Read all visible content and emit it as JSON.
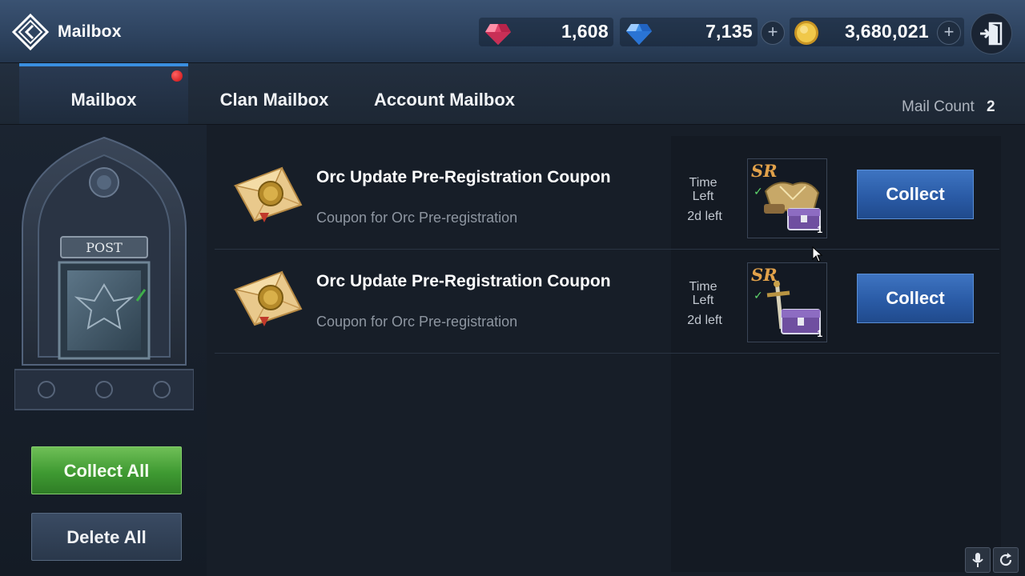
{
  "window": {
    "title": "Mailbox"
  },
  "currencies": [
    {
      "name": "ruby-gem-icon",
      "value": "1,608",
      "color": "#e0436a"
    },
    {
      "name": "blue-diamond-icon",
      "value": "7,135",
      "color": "#3d8ee8"
    },
    {
      "name": "gold-coin-icon",
      "value": "3,680,021",
      "color": "#e2b43a"
    }
  ],
  "plus_symbol": "+",
  "tabs": [
    {
      "label": "Mailbox",
      "active": true,
      "has_notification": true
    },
    {
      "label": "Clan Mailbox",
      "active": false
    },
    {
      "label": "Account Mailbox",
      "active": false
    }
  ],
  "mail_count": {
    "label": "Mail Count",
    "value": "2"
  },
  "sidebar": {
    "post_sign": "POST",
    "collect_all_label": "Collect All",
    "delete_all_label": "Delete All"
  },
  "mails": [
    {
      "title": "Orc Update Pre-Registration Coupon",
      "description": "Coupon for Orc Pre-registration",
      "time_label": "Time Left",
      "time_value": "2d left",
      "reward_grade": "SR",
      "reward_qty": "1",
      "reward_icon": "armor-chest-icon",
      "collect_label": "Collect"
    },
    {
      "title": "Orc Update Pre-Registration Coupon",
      "description": "Coupon for Orc Pre-registration",
      "time_label": "Time Left",
      "time_value": "2d left",
      "reward_grade": "SR",
      "reward_qty": "1",
      "reward_icon": "sword-chest-icon",
      "collect_label": "Collect"
    }
  ],
  "colors": {
    "accent_blue": "#3a8fe0",
    "collect_green": "#4aa83a",
    "collect_blue": "#2a5ba6",
    "notification_red": "#d81a1f",
    "grade_sr": "#e1a14a"
  }
}
